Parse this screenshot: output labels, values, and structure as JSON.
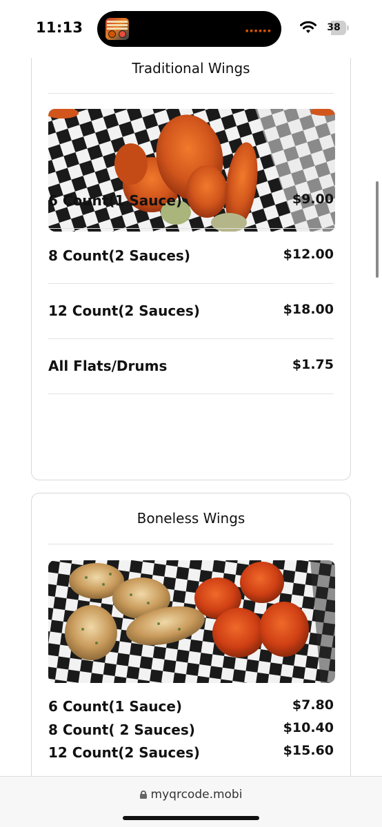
{
  "status_bar": {
    "time": "11:13",
    "battery_level": "38",
    "battery_fraction": 0.38,
    "live_activity_icon": "album-art-icon"
  },
  "menu": {
    "sections": [
      {
        "title": "Traditional Wings",
        "photo": "traditional-wings-photo",
        "items": [
          {
            "name": "6 Count(1 Sauce)",
            "price": "$9.00"
          },
          {
            "name": "8 Count(2 Sauces)",
            "price": "$12.00"
          },
          {
            "name": "12 Count(2 Sauces)",
            "price": "$18.00"
          },
          {
            "name": "All Flats/Drums",
            "price": "$1.75"
          }
        ]
      },
      {
        "title": "Boneless Wings",
        "photo": "boneless-wings-photo",
        "items": [
          {
            "name": "6 Count(1 Sauce)",
            "price": "$7.80"
          },
          {
            "name": "8 Count( 2 Sauces)",
            "price": "$10.40"
          },
          {
            "name": "12 Count(2 Sauces)",
            "price": "$15.60"
          }
        ]
      }
    ]
  },
  "browser": {
    "url": "myqrcode.mobi",
    "lock_icon": "lock-icon"
  },
  "colors": {
    "text": "#111111",
    "card_border": "#d8d8d8",
    "divider": "#e2e2e2",
    "wing_sauce": "#d2561c"
  }
}
